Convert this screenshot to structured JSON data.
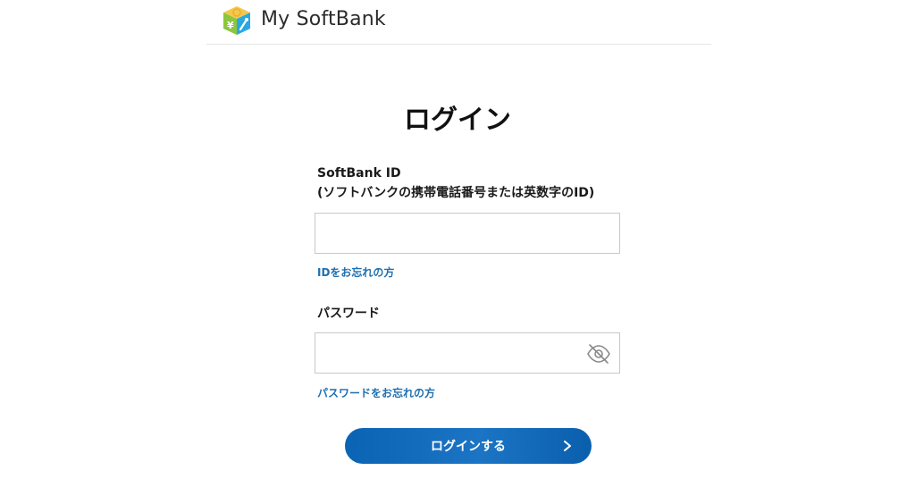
{
  "header": {
    "brand": "My SoftBank",
    "logo_icon": "softbank-cube-logo-icon"
  },
  "main": {
    "title": "ログイン",
    "id_label_line1": "SoftBank ID",
    "id_label_line2": "(ソフトバンクの携帯電話番号または英数字のID)",
    "id_input_value": "",
    "forgot_id_link": "IDをお忘れの方",
    "password_label": "パスワード",
    "password_input_value": "",
    "password_toggle_icon": "eye-slash-icon",
    "forgot_password_link": "パスワードをお忘れの方",
    "login_button": "ログインする",
    "login_button_icon": "chevron-right-icon"
  },
  "colors": {
    "link": "#1f6fb0",
    "button": "#0b63b4",
    "text": "#1a1a1a",
    "border": "#c8c8c8"
  }
}
